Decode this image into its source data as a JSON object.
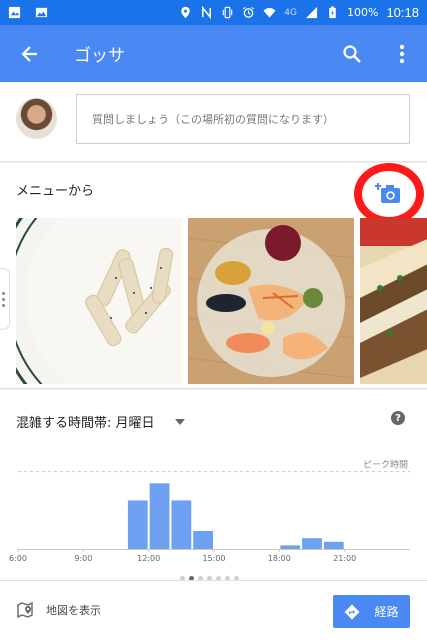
{
  "status_bar": {
    "network": "4G",
    "battery": "100%",
    "time": "10:18"
  },
  "app_bar": {
    "title": "ゴッサ"
  },
  "question": {
    "placeholder": "質問しましょう（この場所初の質問になります）"
  },
  "menu": {
    "title": "メニューから",
    "photos": [
      "cream-pasta",
      "seafood-platter",
      "sandwich"
    ]
  },
  "busy": {
    "title": "混雑する時間帯: 月曜日",
    "peak_label": "ピーク時間",
    "chart_data": {
      "type": "bar",
      "x": [
        6,
        7,
        8,
        9,
        10,
        11,
        12,
        13,
        14,
        15,
        16,
        17,
        18,
        19,
        20,
        21,
        22,
        23
      ],
      "x_tick_labels": [
        "6:00",
        "9:00",
        "12:00",
        "15:00",
        "18:00",
        "21:00"
      ],
      "x_ticks": [
        6,
        9,
        12,
        15,
        18,
        21
      ],
      "values": [
        0,
        0,
        0,
        0,
        0,
        54,
        73,
        54,
        20,
        0,
        0,
        0,
        4,
        12,
        8,
        0,
        0,
        0
      ],
      "peak_line": 86,
      "ylim": [
        0,
        100
      ],
      "highlight_color": "#6fa1f2"
    }
  },
  "bottom": {
    "show_map": "地図を表示",
    "route": "経路"
  },
  "colors": {
    "status_bar": "#1a73e8",
    "app_bar": "#4a89f3",
    "highlight_ring": "#ff1a1a"
  }
}
